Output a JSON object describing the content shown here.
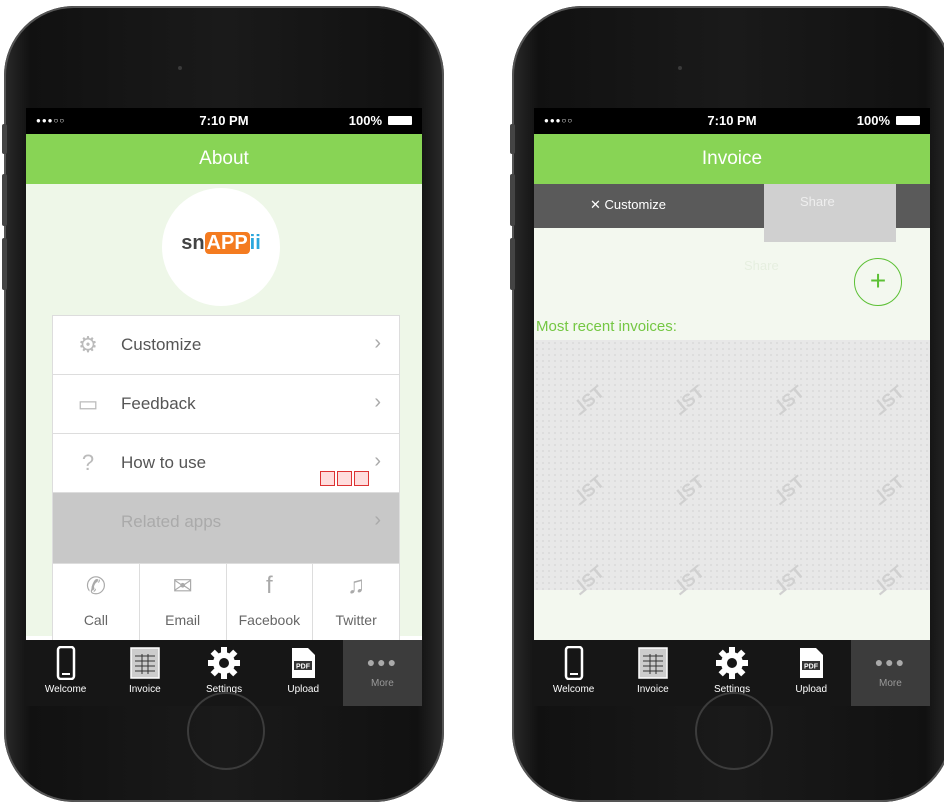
{
  "status_bar": {
    "signal": "●●●○○",
    "time": "7:10 PM",
    "battery": "100%"
  },
  "left_screen": {
    "title": "About",
    "logo": {
      "part1": "sn",
      "part2": "APP",
      "part3": "ii"
    },
    "menu": [
      {
        "label": "Customize",
        "icon": "gear-outline-icon"
      },
      {
        "label": "Feedback",
        "icon": "speech-bubble-icon"
      },
      {
        "label": "How to use",
        "icon": "question-icon"
      },
      {
        "label": "Related apps",
        "icon": "apps-icon"
      }
    ],
    "social": [
      {
        "label": "Call",
        "icon": "phone-icon"
      },
      {
        "label": "Email",
        "icon": "envelope-icon"
      },
      {
        "label": "Facebook",
        "icon": "facebook-icon"
      },
      {
        "label": "Twitter",
        "icon": "twitter-icon"
      }
    ]
  },
  "right_screen": {
    "title": "Invoice",
    "customize_label": "Customize",
    "share_label": "Share",
    "recent_label": "Most recent invoices:",
    "add_label": "+"
  },
  "tabbar": [
    {
      "label": "Welcome",
      "icon": "phone-device-icon"
    },
    {
      "label": "Invoice",
      "icon": "invoice-grid-icon"
    },
    {
      "label": "Settings",
      "icon": "gear-icon"
    },
    {
      "label": "Upload",
      "icon": "pdf-icon",
      "badge": "PDF"
    },
    {
      "label": "More",
      "icon": "more-dots-icon"
    }
  ],
  "colors": {
    "accent": "#88d455",
    "tabbar": "#161616",
    "recent_label": "#74c743"
  }
}
